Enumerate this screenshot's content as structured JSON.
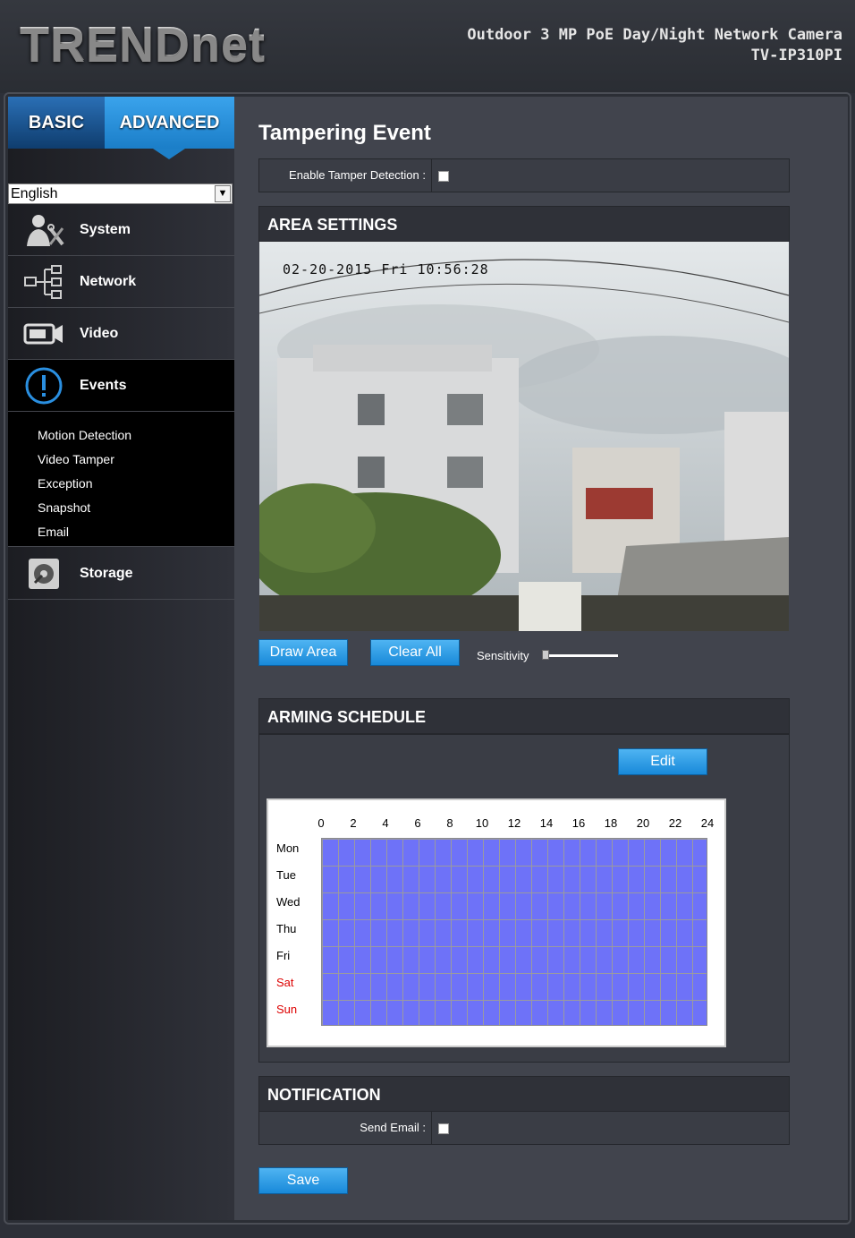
{
  "header": {
    "logo": "TRENDnet",
    "product_line1": "Outdoor 3 MP PoE Day/Night Network Camera",
    "product_line2": "TV-IP310PI"
  },
  "mode_tabs": {
    "basic": "BASIC",
    "advanced": "ADVANCED",
    "active": "ADVANCED"
  },
  "language": {
    "selected": "English"
  },
  "nav": {
    "system": "System",
    "network": "Network",
    "video": "Video",
    "events": "Events",
    "events_sub": [
      "Motion Detection",
      "Video Tamper",
      "Exception",
      "Snapshot",
      "Email"
    ],
    "storage": "Storage",
    "active": "Events"
  },
  "main": {
    "title": "Tampering Event",
    "enable_label": "Enable Tamper Detection :",
    "enable_checked": false,
    "area_header": "AREA SETTINGS",
    "camera_timestamp": "02-20-2015 Fri 10:56:28",
    "draw_area": "Draw Area",
    "clear_all": "Clear All",
    "sensitivity_label": "Sensitivity",
    "sensitivity_level": 0,
    "schedule_header": "ARMING SCHEDULE",
    "edit_label": "Edit",
    "hours": [
      "0",
      "2",
      "4",
      "6",
      "8",
      "10",
      "12",
      "14",
      "16",
      "18",
      "20",
      "22",
      "24"
    ],
    "days": [
      "Mon",
      "Tue",
      "Wed",
      "Thu",
      "Fri",
      "Sat",
      "Sun"
    ],
    "weekend_days": [
      "Sat",
      "Sun"
    ],
    "schedule_color": "#6e72f8",
    "notification_header": "NOTIFICATION",
    "send_email_label": "Send Email :",
    "send_email_checked": false,
    "save_label": "Save"
  },
  "colors": {
    "accent": "#1d80c9",
    "weekend": "#dd0000"
  }
}
